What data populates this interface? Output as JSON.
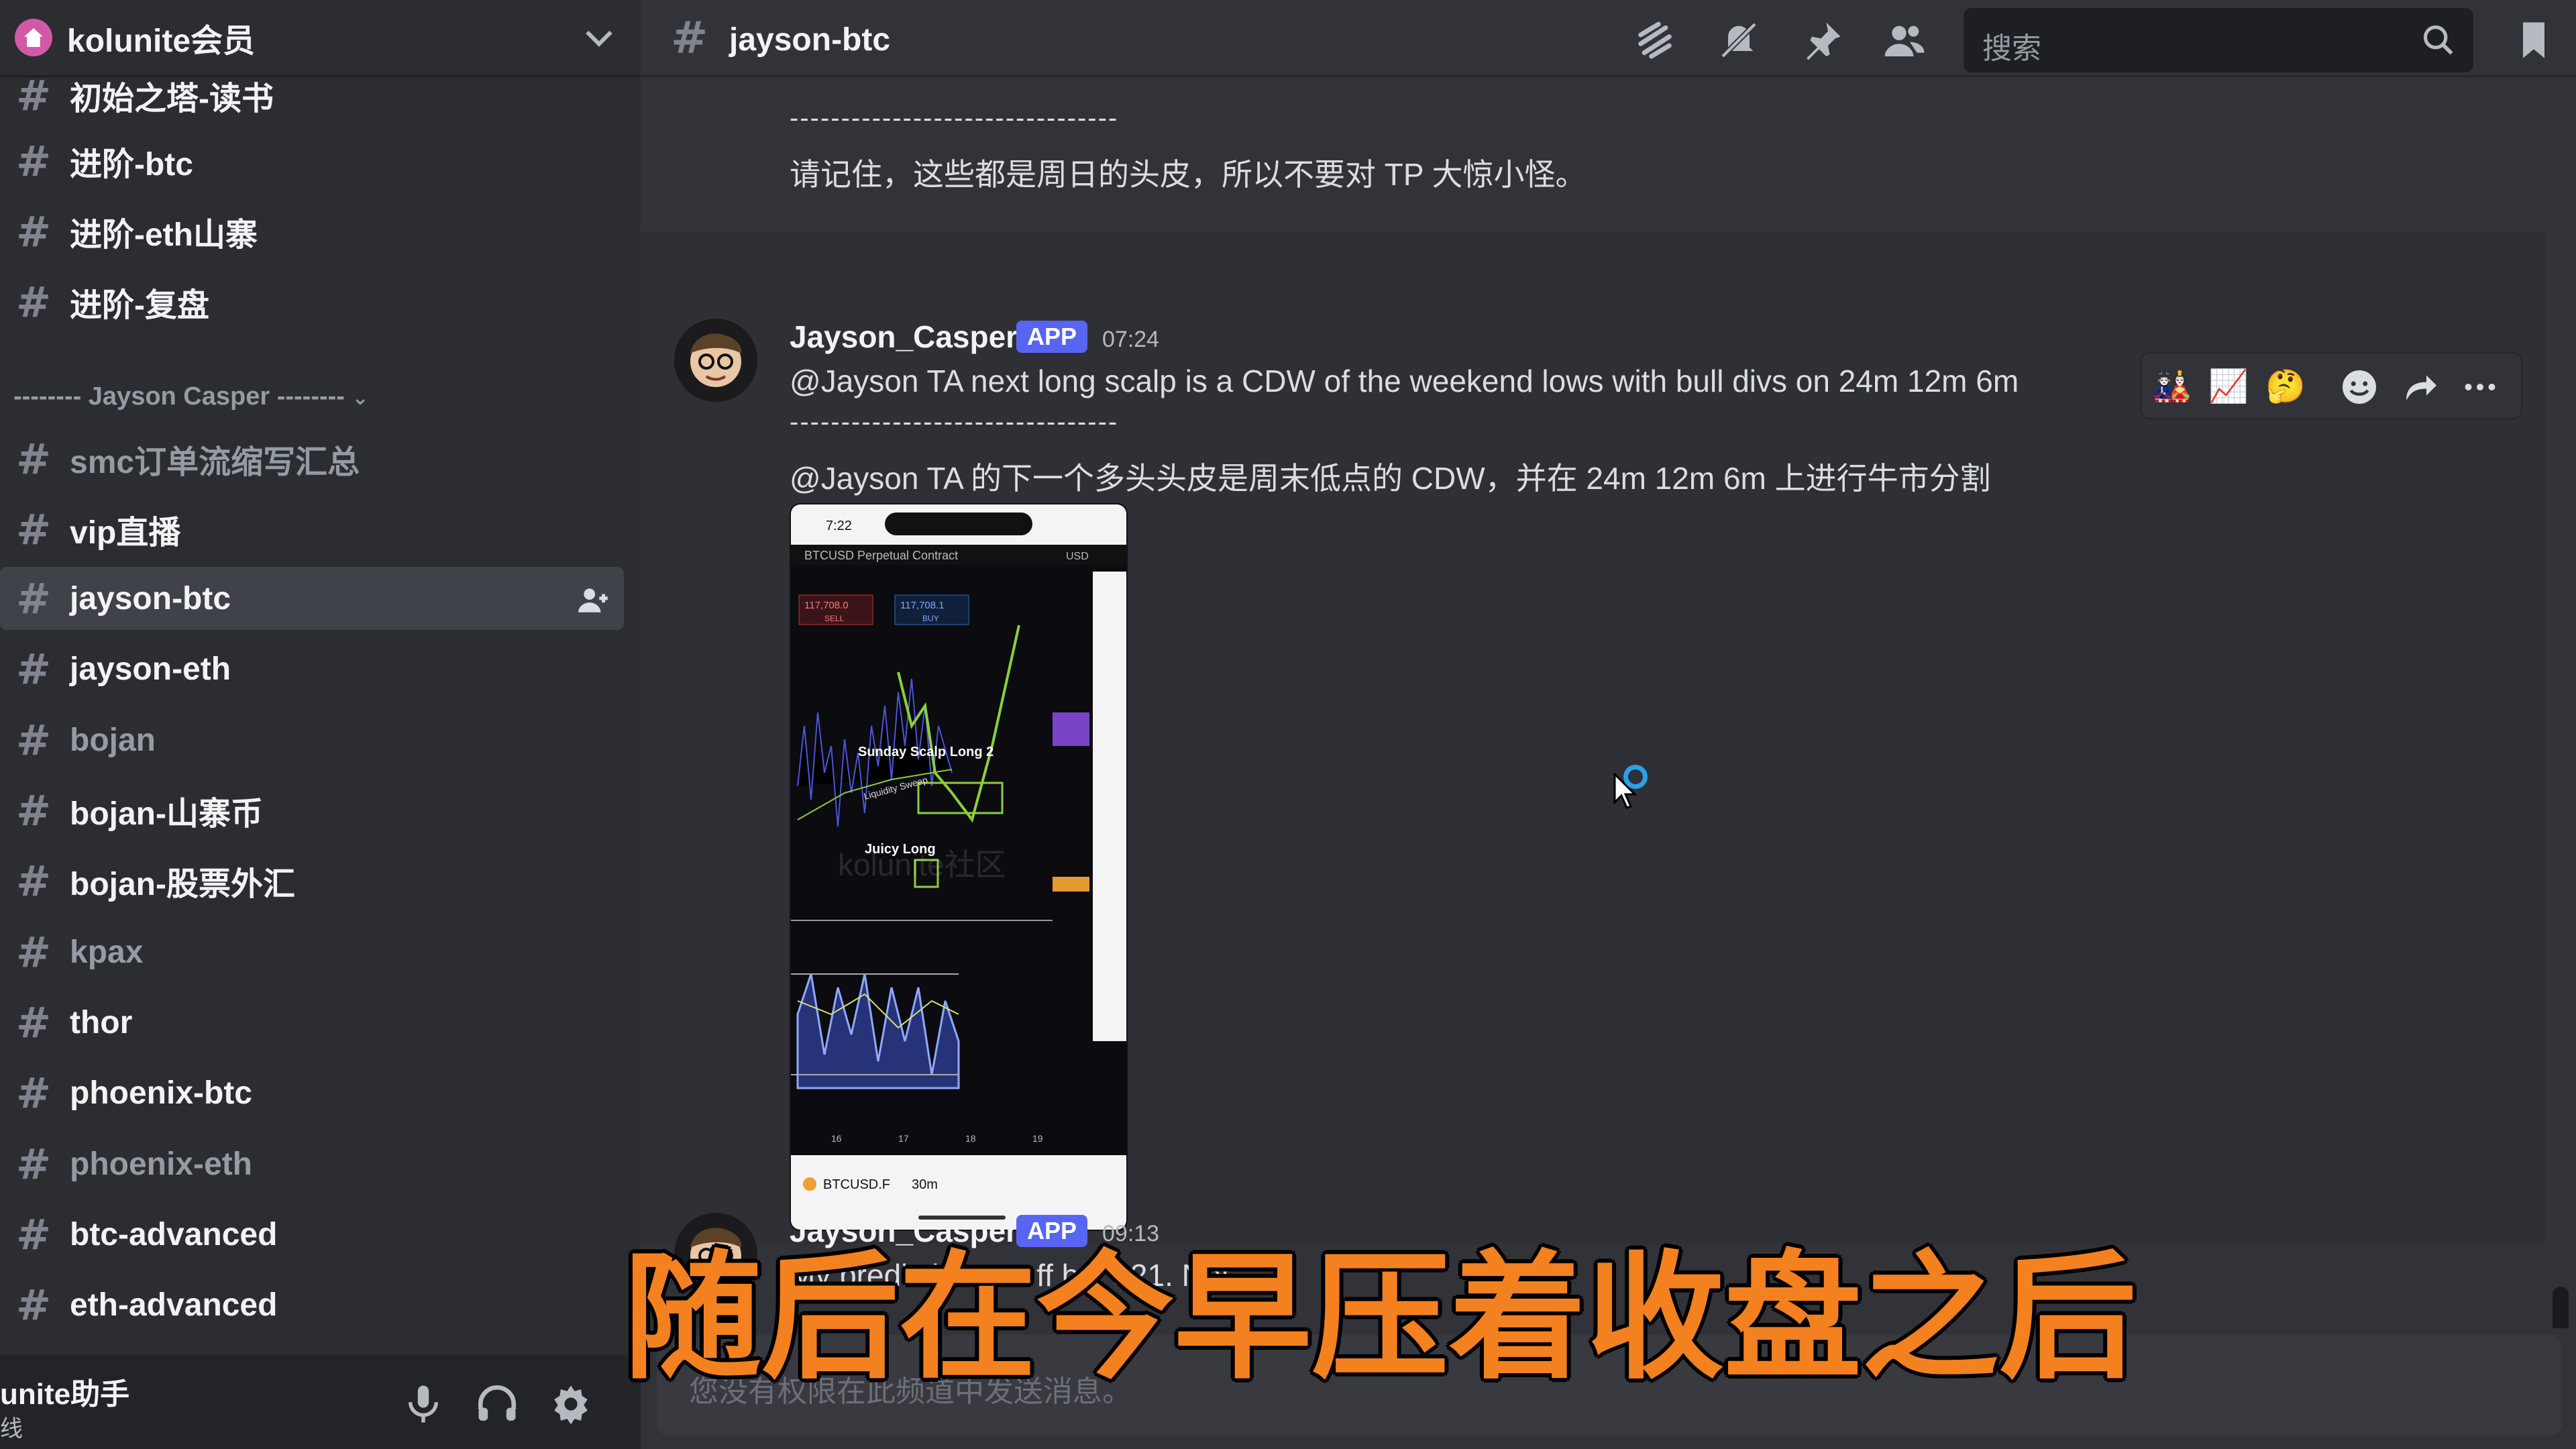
{
  "server": {
    "name": "kolunite会员"
  },
  "sidebar": {
    "category": "-------- Jayson Casper --------",
    "channels": [
      {
        "label": "初始之塔-读书"
      },
      {
        "label": "进阶-btc"
      },
      {
        "label": "进阶-eth山寨"
      },
      {
        "label": "进阶-复盘"
      },
      {
        "label": "smc订单流缩写汇总"
      },
      {
        "label": "vip直播"
      },
      {
        "label": "jayson-btc"
      },
      {
        "label": "jayson-eth"
      },
      {
        "label": "bojan"
      },
      {
        "label": "bojan-山寨币"
      },
      {
        "label": "bojan-股票外汇"
      },
      {
        "label": "kpax"
      },
      {
        "label": "thor"
      },
      {
        "label": "phoenix-btc"
      },
      {
        "label": "phoenix-eth"
      },
      {
        "label": "btc-advanced"
      },
      {
        "label": "eth-advanced"
      }
    ]
  },
  "user_panel": {
    "name": "unite助手",
    "status": "线"
  },
  "topbar": {
    "channel": "jayson-btc",
    "search_placeholder": "搜索",
    "icons": [
      "threads-icon",
      "mute-bell-icon",
      "pin-icon",
      "members-icon",
      "inbox-icon"
    ]
  },
  "messages": {
    "prev_divider": "--------------------------------",
    "prev_text": "请记住，这些都是周日的头皮，所以不要对 TP 大惊小怪。",
    "msg1": {
      "author": "Jayson_Casper",
      "badge": "APP",
      "time": "07:24",
      "line1": "@Jayson TA next long scalp is a CDW of the weekend lows with bull divs on 24m 12m 6m",
      "divider": "--------------------------------",
      "line2": "@Jayson TA 的下一个多头头皮是周末低点的 CDW，并在 24m 12m 6m 上进行牛市分割"
    },
    "msg2": {
      "author": "Jayson_Casper",
      "badge": "APP",
      "time": "09:13",
      "line1": "My prediction w... ff b... $21. Not ... ..."
    }
  },
  "attachment": {
    "phone_time": "7:22",
    "pair": "BTCUSD Perpetual Contract",
    "currency": "USD",
    "sell": "117,708.0",
    "buy": "117,708.1",
    "sell_label": "SELL",
    "buy_label": "BUY",
    "label1": "Sunday Scalp Long 2",
    "label2": "Juicy Long",
    "label3": "Liquidity Sweep",
    "ticker": "BTCUSD.F",
    "timeframe": "30m",
    "xticks": [
      "16",
      "17",
      "18",
      "19"
    ],
    "watermark": "kolunite社区"
  },
  "composer": {
    "placeholder": "您没有权限在此频道中发送消息。"
  },
  "subtitle": "随后在今早压着收盘之后"
}
